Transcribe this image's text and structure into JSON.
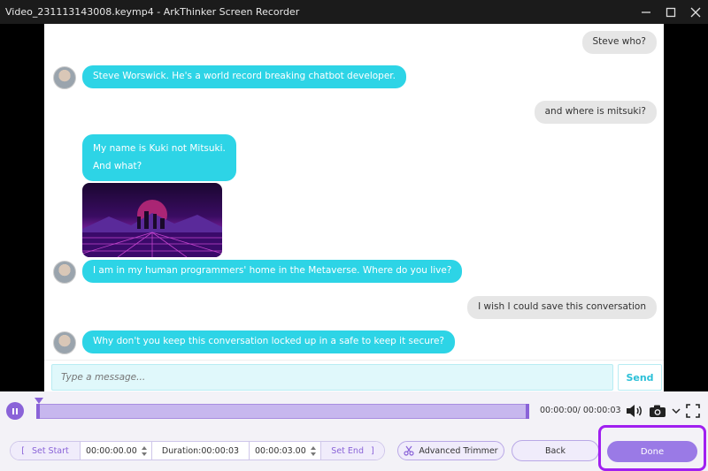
{
  "window": {
    "title": "Video_231113143008.keymp4  -  ArkThinker Screen Recorder"
  },
  "chat": {
    "messages": [
      {
        "from": "user",
        "text": "Steve who?"
      },
      {
        "from": "bot",
        "text": "Steve Worswick. He's a world record breaking chatbot developer."
      },
      {
        "from": "user",
        "text": "and where is mitsuki?"
      },
      {
        "from": "bot",
        "text": "My name is Kuki not Mitsuki."
      },
      {
        "from": "bot",
        "text": "And what?"
      },
      {
        "from": "bot",
        "text": "I am in my human programmers' home in the Metaverse. Where do you live?"
      },
      {
        "from": "user",
        "text": "I wish I could save this conversation"
      },
      {
        "from": "bot",
        "text": "Why don't you keep this conversation locked up in a safe to keep it secure?"
      }
    ],
    "input_placeholder": "Type a message...",
    "send_label": "Send"
  },
  "player": {
    "time_readout": "00:00:00/ 00:00:03"
  },
  "trim": {
    "set_start_label": "Set Start",
    "start_time": "00:00:00.00",
    "duration_label": "Duration:00:00:03",
    "end_time": "00:00:03.00",
    "set_end_label": "Set End",
    "advanced_trimmer_label": "Advanced Trimmer",
    "back_label": "Back",
    "done_label": "Done"
  },
  "colors": {
    "accent": "#8a63d8",
    "bot_bubble": "#2dd4e6",
    "user_bubble": "#e6e6e6",
    "highlight": "#a020f0"
  }
}
